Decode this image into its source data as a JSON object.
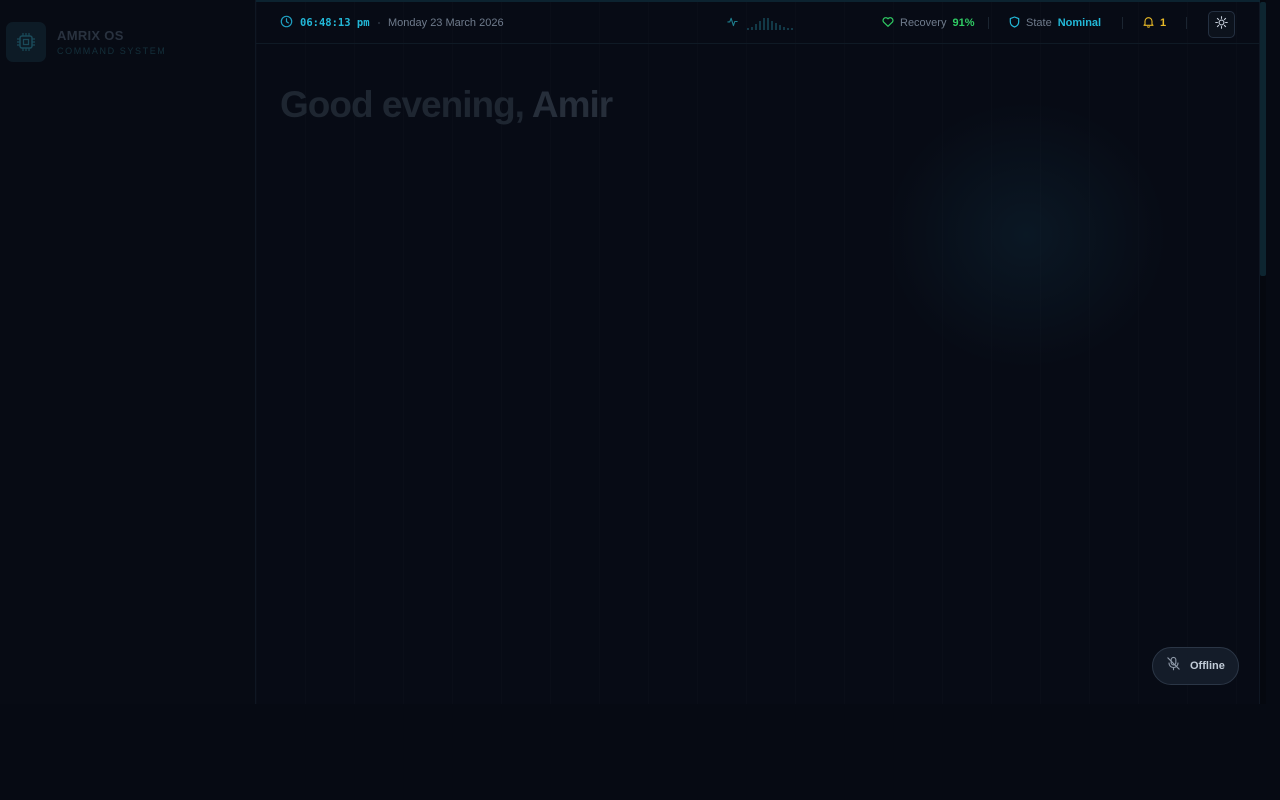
{
  "brand": {
    "name": "AMRIX OS",
    "subtitle": "COMMAND SYSTEM",
    "logo_icon": "chip-icon"
  },
  "topbar": {
    "clock_icon": "clock-icon",
    "time": "06:48:13 pm",
    "date": "Monday 23 March 2026",
    "activity_icon": "activity-icon",
    "recovery_icon": "heart-icon",
    "recovery_label": "Recovery",
    "recovery_value": "91%",
    "state_icon": "shield-icon",
    "state_label": "State",
    "state_value": "Nominal",
    "notification_icon": "bell-icon",
    "notification_count": "1",
    "theme_toggle_icon": "sun-icon"
  },
  "main": {
    "greeting_prefix": "Good evening,",
    "greeting_name": "Amir"
  },
  "voice": {
    "status_icon": "mic-off-icon",
    "status_label": "Offline"
  },
  "colors": {
    "background": "#060a13",
    "accent_cyan": "#22b8d8",
    "recovery_green": "#2fca63",
    "notification_yellow": "#e8b926"
  }
}
